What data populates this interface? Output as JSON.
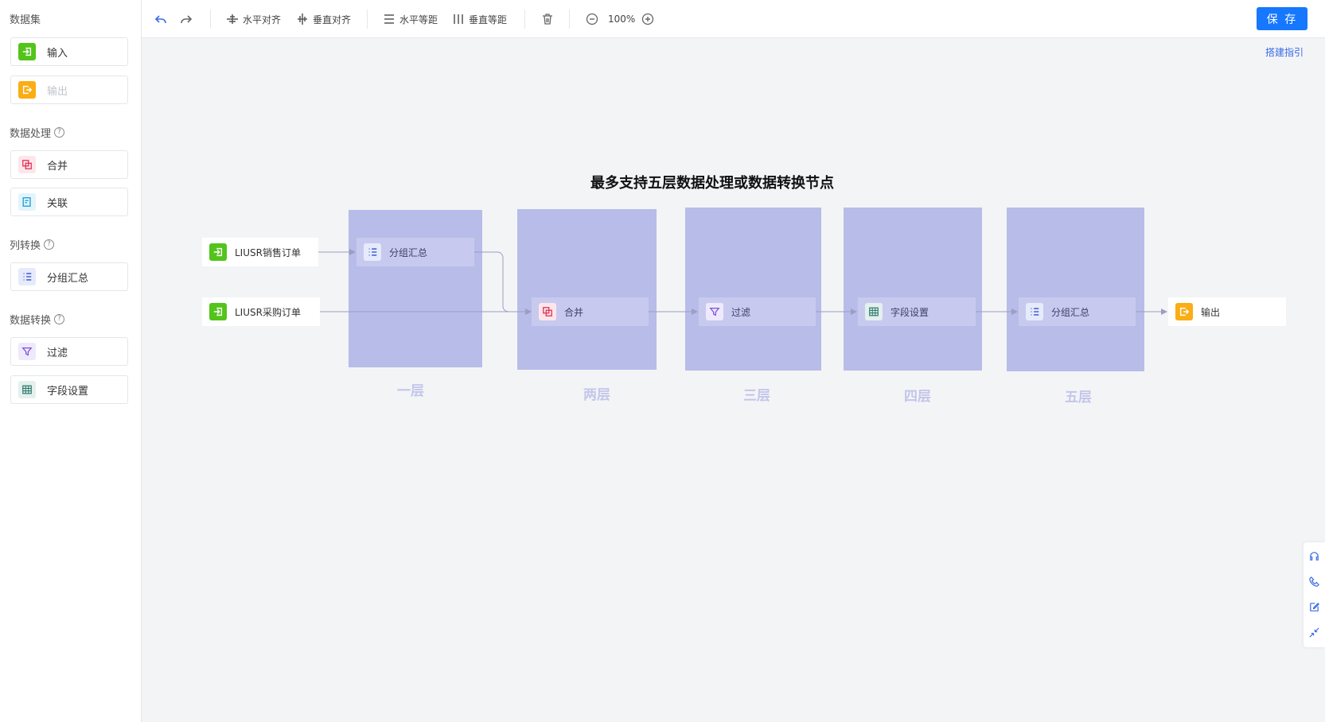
{
  "sidebar": {
    "sections": {
      "dataset": "数据集",
      "processing": "数据处理",
      "column": "列转换",
      "transform": "数据转换"
    },
    "items": {
      "input": "输入",
      "output": "输出",
      "merge": "合并",
      "relate": "关联",
      "group": "分组汇总",
      "filter": "过滤",
      "fields": "字段设置"
    }
  },
  "toolbar": {
    "h_align": "水平对齐",
    "v_align": "垂直对齐",
    "h_spacing": "水平等距",
    "v_spacing": "垂直等距",
    "zoom": "100%",
    "save": "保 存"
  },
  "guide": "搭建指引",
  "diagram": {
    "title": "最多支持五层数据处理或数据转换节点",
    "layers": [
      "一层",
      "两层",
      "三层",
      "四层",
      "五层"
    ],
    "nodes": {
      "sales": "LIUSR销售订单",
      "purchase": "LIUSR采购订单",
      "group1": "分组汇总",
      "merge": "合并",
      "filter": "过滤",
      "fields": "字段设置",
      "group2": "分组汇总",
      "output": "输出"
    }
  },
  "colors": {
    "primary": "#1677ff",
    "layer": "#b8bce9",
    "input_green": "#52c41a",
    "output_orange": "#faad14"
  }
}
